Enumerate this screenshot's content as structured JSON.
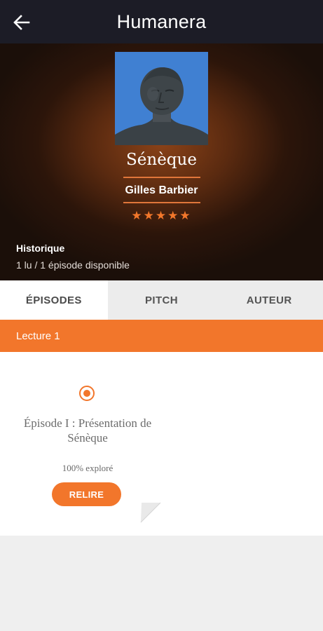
{
  "appbar": {
    "title": "Humanera",
    "back_icon": "arrow-left-icon"
  },
  "hero": {
    "book_title": "Sénèque",
    "author": "Gilles Barbier",
    "rating": 5,
    "rating_stars": "★★★★★",
    "history_label": "Historique",
    "history_value": "1 lu / 1 épisode disponible"
  },
  "tabs": [
    {
      "label": "ÉPISODES",
      "active": true
    },
    {
      "label": "PITCH",
      "active": false
    },
    {
      "label": "AUTEUR",
      "active": false
    }
  ],
  "section": {
    "label": "Lecture 1"
  },
  "episodes": [
    {
      "title": "Épisode I : Présentation de Sénèque",
      "progress": "100% exploré",
      "button": "RELIRE"
    }
  ],
  "colors": {
    "accent": "#f2762b",
    "appbar": "#1c1c26",
    "cover_sky": "#3f7fd0"
  }
}
